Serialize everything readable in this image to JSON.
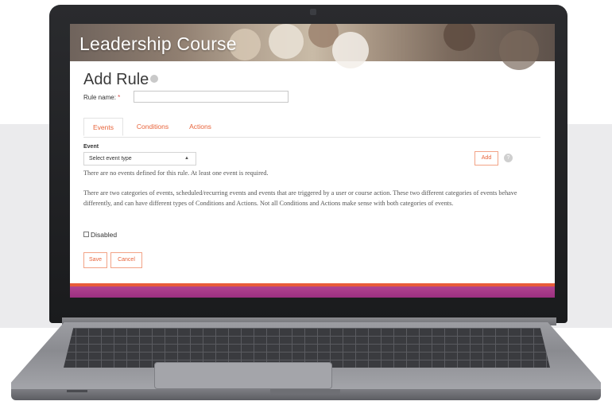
{
  "banner": {
    "title": "Leadership Course"
  },
  "page": {
    "title": "Add Rule"
  },
  "rule_name": {
    "label": "Rule name:",
    "required_mark": "*",
    "value": ""
  },
  "tabs": [
    {
      "label": "Events",
      "active": true
    },
    {
      "label": "Conditions",
      "active": false
    },
    {
      "label": "Actions",
      "active": false
    }
  ],
  "event": {
    "label": "Event",
    "select_value": "Select event type",
    "add_button": "Add",
    "help_icon": "question-icon",
    "no_events_text": "There are no events defined for this rule. At least one event is required.",
    "description": "There are two categories of events, scheduled/recurring events and events that are triggered by a user or course action. These two different categories of events behave differently, and can have different types of Conditions and Actions. Not all Conditions and Actions make sense with both categories of events."
  },
  "disabled": {
    "label": "Disabled",
    "checked": false
  },
  "buttons": {
    "save": "Save",
    "cancel": "Cancel"
  },
  "colors": {
    "accent": "#e8643b",
    "footer_band": "#9c2f80",
    "background_band": "#ebebed"
  }
}
